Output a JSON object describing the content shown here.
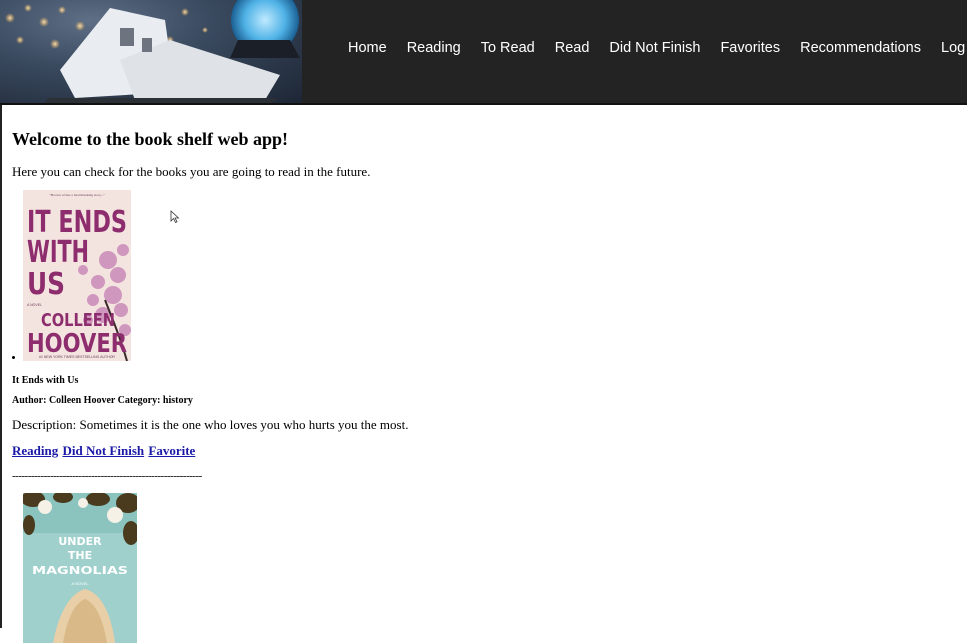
{
  "nav": {
    "items": [
      {
        "label": "Home"
      },
      {
        "label": "Reading"
      },
      {
        "label": "To Read"
      },
      {
        "label": "Read"
      },
      {
        "label": "Did Not Finish"
      },
      {
        "label": "Favorites"
      },
      {
        "label": "Recommendations"
      },
      {
        "label": "Log Out"
      }
    ]
  },
  "main": {
    "heading": "Welcome to the book shelf web app!",
    "intro": "Here you can check for the books you are going to read in the future."
  },
  "books": [
    {
      "cover": {
        "line1": "IT ENDS",
        "line2": "WITH",
        "line3": "US",
        "author_line1": "COLLEEN",
        "author_line2": "HOOVER",
        "top_blurb": "\"Hoover writes a heartbreaking story...\"",
        "bottom_blurb": "#1 NEW YORK TIMES BESTSELLING AUTHOR",
        "tag": "A NOVEL"
      },
      "title": "It Ends with Us",
      "meta": "Author: Colleen Hoover Category: history",
      "description": "Description: Sometimes it is the one who loves you who hurts you the most.",
      "links": {
        "reading": "Reading",
        "dnf": "Did Not Finish",
        "favorite": "Favorite"
      },
      "separator": "------------------------------------------------------------"
    },
    {
      "cover": {
        "line1": "UNDER",
        "line2": "THE",
        "line3": "MAGNOLIAS",
        "tag": "A NOVEL"
      }
    }
  ],
  "colors": {
    "header_bg": "#232323",
    "link": "#1a1aa6"
  }
}
